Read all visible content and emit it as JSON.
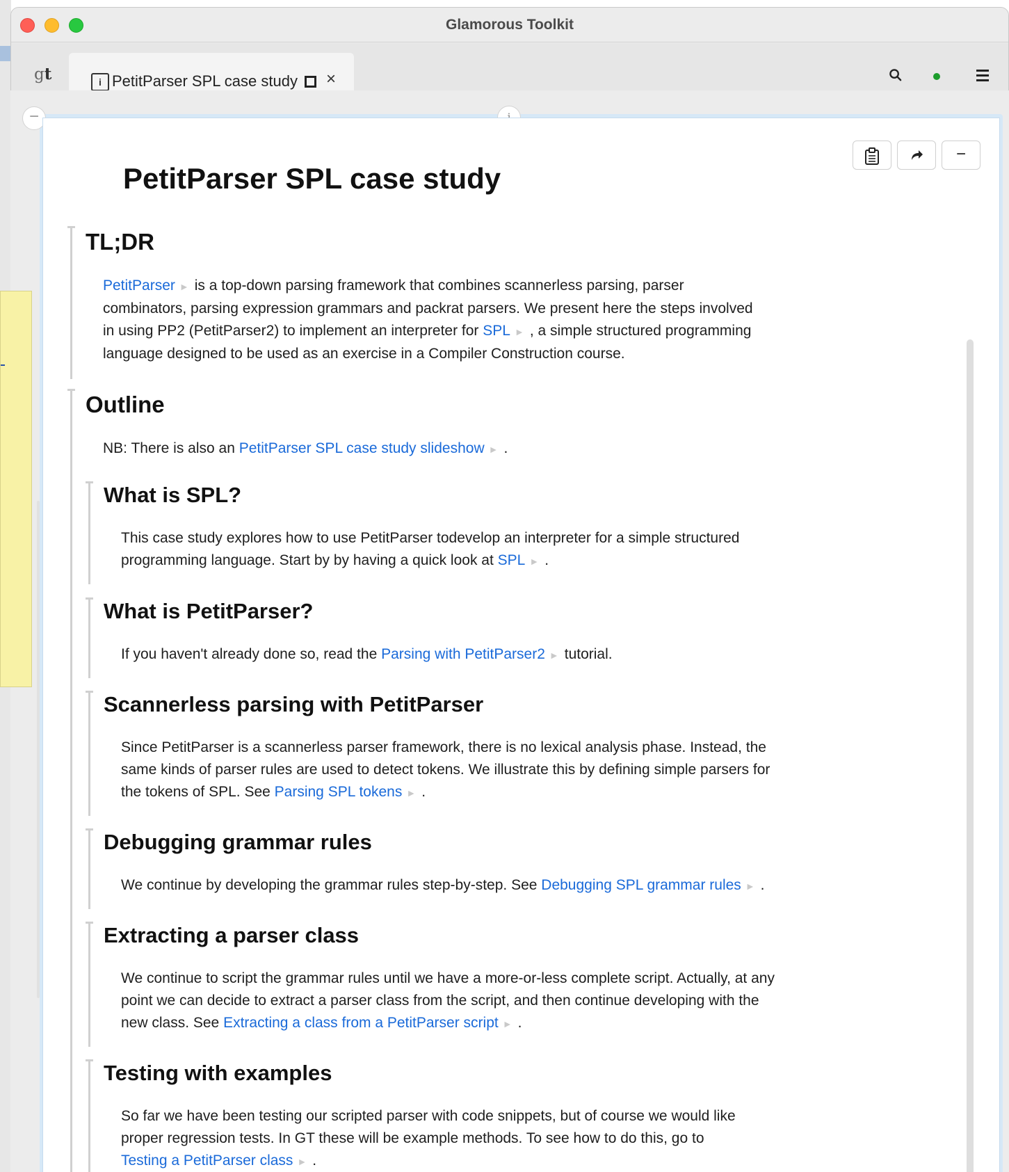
{
  "window": {
    "title": "Glamorous Toolkit"
  },
  "tabbar": {
    "gt_label_prefix": "g",
    "gt_label_suffix": "t",
    "tab_label": "PetitParser SPL case study",
    "tab_icon": "i",
    "icons": [
      "search-icon",
      "status-dot-icon",
      "hamburger-menu-icon"
    ],
    "status_color": "#1c9c2c"
  },
  "page": {
    "title": "PetitParser SPL case study",
    "collapse_glyph": "−",
    "info_glyph": "i",
    "actions": {
      "inspect_icon": "clipboard-icon",
      "share_icon": "share-arrow-icon",
      "minus_glyph": "−"
    }
  },
  "sections": {
    "tldr": {
      "heading": "TL;DR",
      "link1": "PetitParser",
      "text1": "is a top-down parsing framework that combines scannerless parsing, parser",
      "text2": "combinators, parsing expression grammars and packrat parsers. We present here the steps involved",
      "text3": "in using PP2 (PetitParser2) to implement an interpreter for",
      "link2": "SPL",
      "text4": ", a simple structured programming",
      "text5": "language designed to be used as an exercise in a Compiler Construction course."
    },
    "outline": {
      "heading": "Outline",
      "text1": "NB: There is also an",
      "link1": "PetitParser SPL case study slideshow",
      "text2": "."
    },
    "what_spl": {
      "heading": "What is SPL?",
      "text1": "This case study explores how to use PetitParser todevelop an interpreter for a simple structured",
      "text2": "programming language. Start by by having a quick look at",
      "link1": "SPL",
      "text3": "."
    },
    "what_pp": {
      "heading": "What is PetitParser?",
      "text1": "If you haven't already done so, read the",
      "link1": "Parsing with PetitParser2",
      "text2": "tutorial."
    },
    "scannerless": {
      "heading": "Scannerless parsing with PetitParser",
      "text1": "Since PetitParser is a scannerless parser framework, there is no lexical analysis phase. Instead, the",
      "text2": "same kinds of parser rules are used to detect tokens. We illustrate this by defining simple parsers for",
      "text3": "the tokens of SPL. See",
      "link1": "Parsing SPL tokens",
      "text4": "."
    },
    "debugging": {
      "heading": "Debugging grammar rules",
      "text1": "We continue by developing the grammar rules step-by-step. See",
      "link1": "Debugging SPL grammar rules",
      "text2": "."
    },
    "extracting": {
      "heading": "Extracting a parser class",
      "text1": "We continue to script the grammar rules until we have a more-or-less complete script. Actually, at any",
      "text2": "point we can decide to extract a parser class from the script, and then continue developing with the",
      "text3": "new class. See",
      "link1": "Extracting a class from a PetitParser script",
      "text4": "."
    },
    "testing": {
      "heading": "Testing with examples",
      "text1": "So far we have been testing our scripted parser with code snippets, but of course we would like",
      "text2": "proper regression tests. In GT these will be example methods. To see how to do this, go to",
      "link1": "Testing a PetitParser class",
      "text3": "."
    }
  },
  "link_arrow": "►"
}
